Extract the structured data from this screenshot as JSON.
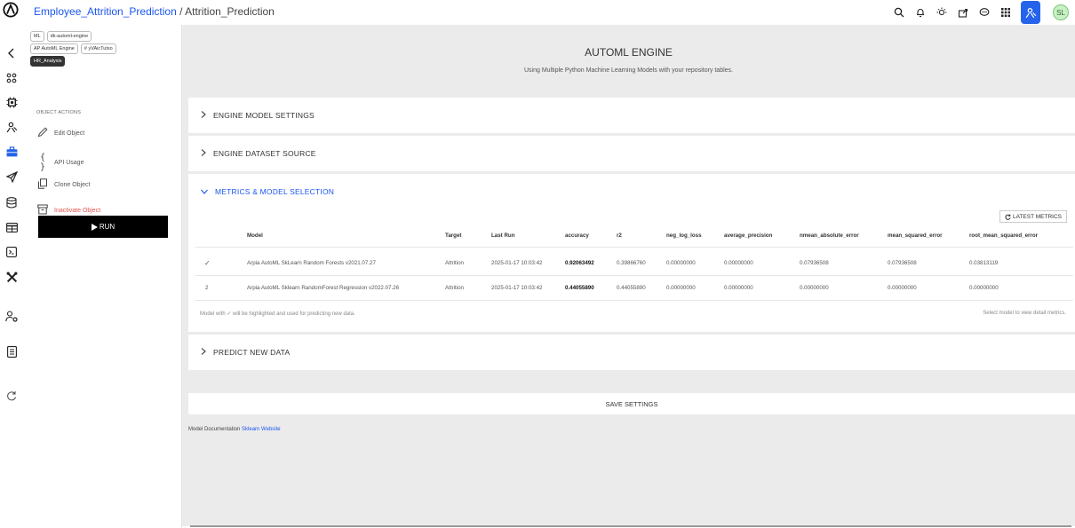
{
  "breadcrumb": {
    "project": "Employee_Attrition_Prediction",
    "separator": " / ",
    "current": "Attrition_Prediction"
  },
  "topbar": {
    "icons": [
      "search-icon",
      "bell-icon",
      "bulb-icon",
      "share-icon",
      "chat-icon",
      "grid-icon",
      "user-icon"
    ],
    "avatar_initials": "SL",
    "accent": "#2563eb"
  },
  "rail": {
    "icons": [
      "back-icon",
      "apps-icon",
      "chip-icon",
      "user-network-icon",
      "briefcase-icon",
      "send-icon",
      "database-icon",
      "table-icon",
      "terminal-icon",
      "tools-icon",
      "user-settings-icon",
      "book-icon",
      "refresh-icon"
    ]
  },
  "object": {
    "tags": [
      "ML",
      "dk-automl-engine",
      "AP AutoML Engine",
      "# yVAicTutxo",
      "HR_Analysis"
    ],
    "actions_title": "OBJECT ACTIONS",
    "actions": [
      "Edit Object",
      "API Usage",
      "Clone Object",
      "Inactivate Object"
    ],
    "run_label": "RUN"
  },
  "header": {
    "title": "AUTOML ENGINE",
    "subtitle": "Using Multiple Python Machine Learning Models with your repository tables."
  },
  "sections": {
    "settings": "ENGINE MODEL SETTINGS",
    "dataset": "ENGINE DATASET SOURCE",
    "metrics": "METRICS & MODEL SELECTION",
    "predict": "PREDICT NEW DATA"
  },
  "metrics": {
    "latest_label": "LATEST METRICS",
    "columns": [
      "Model",
      "Target",
      "Last Run",
      "accuracy",
      "r2",
      "neg_log_loss",
      "average_precision",
      "nmean_absolute_error",
      "mean_squared_error",
      "root_mean_squared_error"
    ],
    "rows": [
      {
        "marker": "✓",
        "model": "Arpia AutoML SkLearn Random Forests v2021.07.27",
        "target": "Attrition",
        "last_run": "2025-01-17 10:03:42",
        "accuracy": "0.92063492",
        "r2": "0.39866760",
        "neg_log_loss": "0.00000000",
        "average_precision": "0.00000000",
        "nmae": "0.07936508",
        "mse": "0.07936508",
        "rmse": "0.03813119"
      },
      {
        "marker": "2",
        "model": "Arpia AutoML Sklearn RandomForest Regression v2022.07.26",
        "target": "Attrition",
        "last_run": "2025-01-17 10:03:42",
        "accuracy": "0.44055890",
        "r2": "0.44055890",
        "neg_log_loss": "0.00000000",
        "average_precision": "0.00000000",
        "nmae": "0.00000000",
        "mse": "0.00000000",
        "rmse": "0.00000000"
      }
    ],
    "note_left": "Model with ✓ will be highlighted and used for predicting new data.",
    "note_right": "Select model to view detail metrics."
  },
  "save_label": "SAVE SETTINGS",
  "doc": {
    "prefix": "Model Documentation ",
    "link": "Sklearn Website"
  }
}
